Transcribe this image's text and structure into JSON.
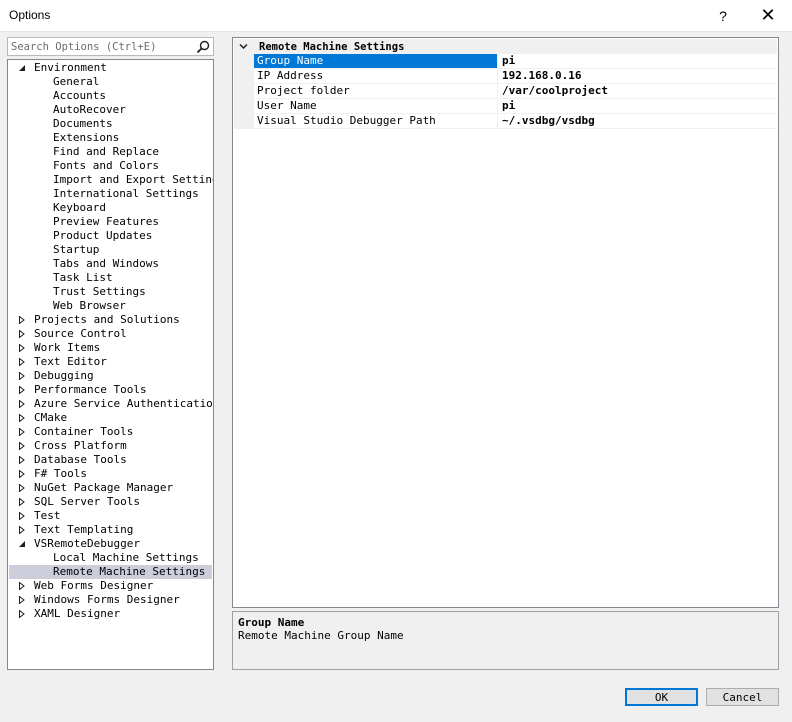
{
  "window": {
    "title": "Options",
    "help_label": "?",
    "close_label": "✕"
  },
  "search": {
    "placeholder": "Search Options (Ctrl+E)"
  },
  "tree": [
    {
      "label": "Environment",
      "level": 0,
      "toggle": "expanded"
    },
    {
      "label": "General",
      "level": 1
    },
    {
      "label": "Accounts",
      "level": 1
    },
    {
      "label": "AutoRecover",
      "level": 1
    },
    {
      "label": "Documents",
      "level": 1
    },
    {
      "label": "Extensions",
      "level": 1
    },
    {
      "label": "Find and Replace",
      "level": 1
    },
    {
      "label": "Fonts and Colors",
      "level": 1
    },
    {
      "label": "Import and Export Settings",
      "level": 1
    },
    {
      "label": "International Settings",
      "level": 1
    },
    {
      "label": "Keyboard",
      "level": 1
    },
    {
      "label": "Preview Features",
      "level": 1
    },
    {
      "label": "Product Updates",
      "level": 1
    },
    {
      "label": "Startup",
      "level": 1
    },
    {
      "label": "Tabs and Windows",
      "level": 1
    },
    {
      "label": "Task List",
      "level": 1
    },
    {
      "label": "Trust Settings",
      "level": 1
    },
    {
      "label": "Web Browser",
      "level": 1
    },
    {
      "label": "Projects and Solutions",
      "level": 0,
      "toggle": "collapsed"
    },
    {
      "label": "Source Control",
      "level": 0,
      "toggle": "collapsed"
    },
    {
      "label": "Work Items",
      "level": 0,
      "toggle": "collapsed"
    },
    {
      "label": "Text Editor",
      "level": 0,
      "toggle": "collapsed"
    },
    {
      "label": "Debugging",
      "level": 0,
      "toggle": "collapsed"
    },
    {
      "label": "Performance Tools",
      "level": 0,
      "toggle": "collapsed"
    },
    {
      "label": "Azure Service Authentication",
      "level": 0,
      "toggle": "collapsed"
    },
    {
      "label": "CMake",
      "level": 0,
      "toggle": "collapsed"
    },
    {
      "label": "Container Tools",
      "level": 0,
      "toggle": "collapsed"
    },
    {
      "label": "Cross Platform",
      "level": 0,
      "toggle": "collapsed"
    },
    {
      "label": "Database Tools",
      "level": 0,
      "toggle": "collapsed"
    },
    {
      "label": "F# Tools",
      "level": 0,
      "toggle": "collapsed"
    },
    {
      "label": "NuGet Package Manager",
      "level": 0,
      "toggle": "collapsed"
    },
    {
      "label": "SQL Server Tools",
      "level": 0,
      "toggle": "collapsed"
    },
    {
      "label": "Test",
      "level": 0,
      "toggle": "collapsed"
    },
    {
      "label": "Text Templating",
      "level": 0,
      "toggle": "collapsed"
    },
    {
      "label": "VSRemoteDebugger",
      "level": 0,
      "toggle": "expanded"
    },
    {
      "label": "Local Machine Settings",
      "level": 1
    },
    {
      "label": "Remote Machine Settings",
      "level": 1,
      "selected": true
    },
    {
      "label": "Web Forms Designer",
      "level": 0,
      "toggle": "collapsed"
    },
    {
      "label": "Windows Forms Designer",
      "level": 0,
      "toggle": "collapsed"
    },
    {
      "label": "XAML Designer",
      "level": 0,
      "toggle": "collapsed"
    }
  ],
  "property_grid": {
    "category": "Remote Machine Settings",
    "properties": [
      {
        "name": "Group Name",
        "value": "pi",
        "active": true
      },
      {
        "name": "IP Address",
        "value": "192.168.0.16"
      },
      {
        "name": "Project folder",
        "value": "/var/coolproject"
      },
      {
        "name": "User Name",
        "value": "pi"
      },
      {
        "name": "Visual Studio Debugger Path",
        "value": "~/.vsdbg/vsdbg"
      }
    ]
  },
  "description": {
    "title": "Group Name",
    "text": "Remote Machine Group Name"
  },
  "buttons": {
    "ok": "OK",
    "cancel": "Cancel"
  },
  "colors": {
    "selection": "#0078d7",
    "tree_selected": "#cccedb",
    "background": "#f0f0f0"
  }
}
